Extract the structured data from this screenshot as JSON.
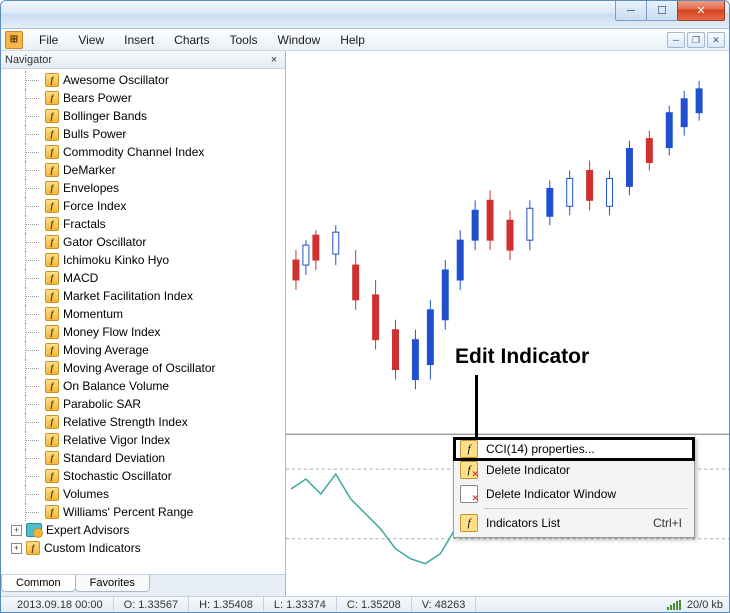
{
  "menu": {
    "file": "File",
    "view": "View",
    "insert": "Insert",
    "charts": "Charts",
    "tools": "Tools",
    "window": "Window",
    "help": "Help"
  },
  "navigator": {
    "title": "Navigator",
    "tabs": {
      "common": "Common",
      "favorites": "Favorites"
    },
    "indicators": [
      "Awesome Oscillator",
      "Bears Power",
      "Bollinger Bands",
      "Bulls Power",
      "Commodity Channel Index",
      "DeMarker",
      "Envelopes",
      "Force Index",
      "Fractals",
      "Gator Oscillator",
      "Ichimoku Kinko Hyo",
      "MACD",
      "Market Facilitation Index",
      "Momentum",
      "Money Flow Index",
      "Moving Average",
      "Moving Average of Oscillator",
      "On Balance Volume",
      "Parabolic SAR",
      "Relative Strength Index",
      "Relative Vigor Index",
      "Standard Deviation",
      "Stochastic Oscillator",
      "Volumes",
      "Williams' Percent Range"
    ],
    "groups": {
      "expert_advisors": "Expert Advisors",
      "custom_indicators": "Custom Indicators"
    }
  },
  "context_menu": {
    "properties": "CCI(14) properties...",
    "delete_indicator": "Delete Indicator",
    "delete_window": "Delete Indicator Window",
    "indicators_list": "Indicators List",
    "shortcut": "Ctrl+I"
  },
  "annotation": "Edit Indicator",
  "statusbar": {
    "datetime": "2013.09.18 00:00",
    "open": "O: 1.33567",
    "high": "H: 1.35408",
    "low": "L: 1.33374",
    "close": "C: 1.35208",
    "volume": "V: 48263",
    "net": "20/0 kb"
  },
  "chart_data": {
    "type": "line",
    "indicator": "CCI(14)",
    "levels": [
      100,
      -100
    ]
  }
}
